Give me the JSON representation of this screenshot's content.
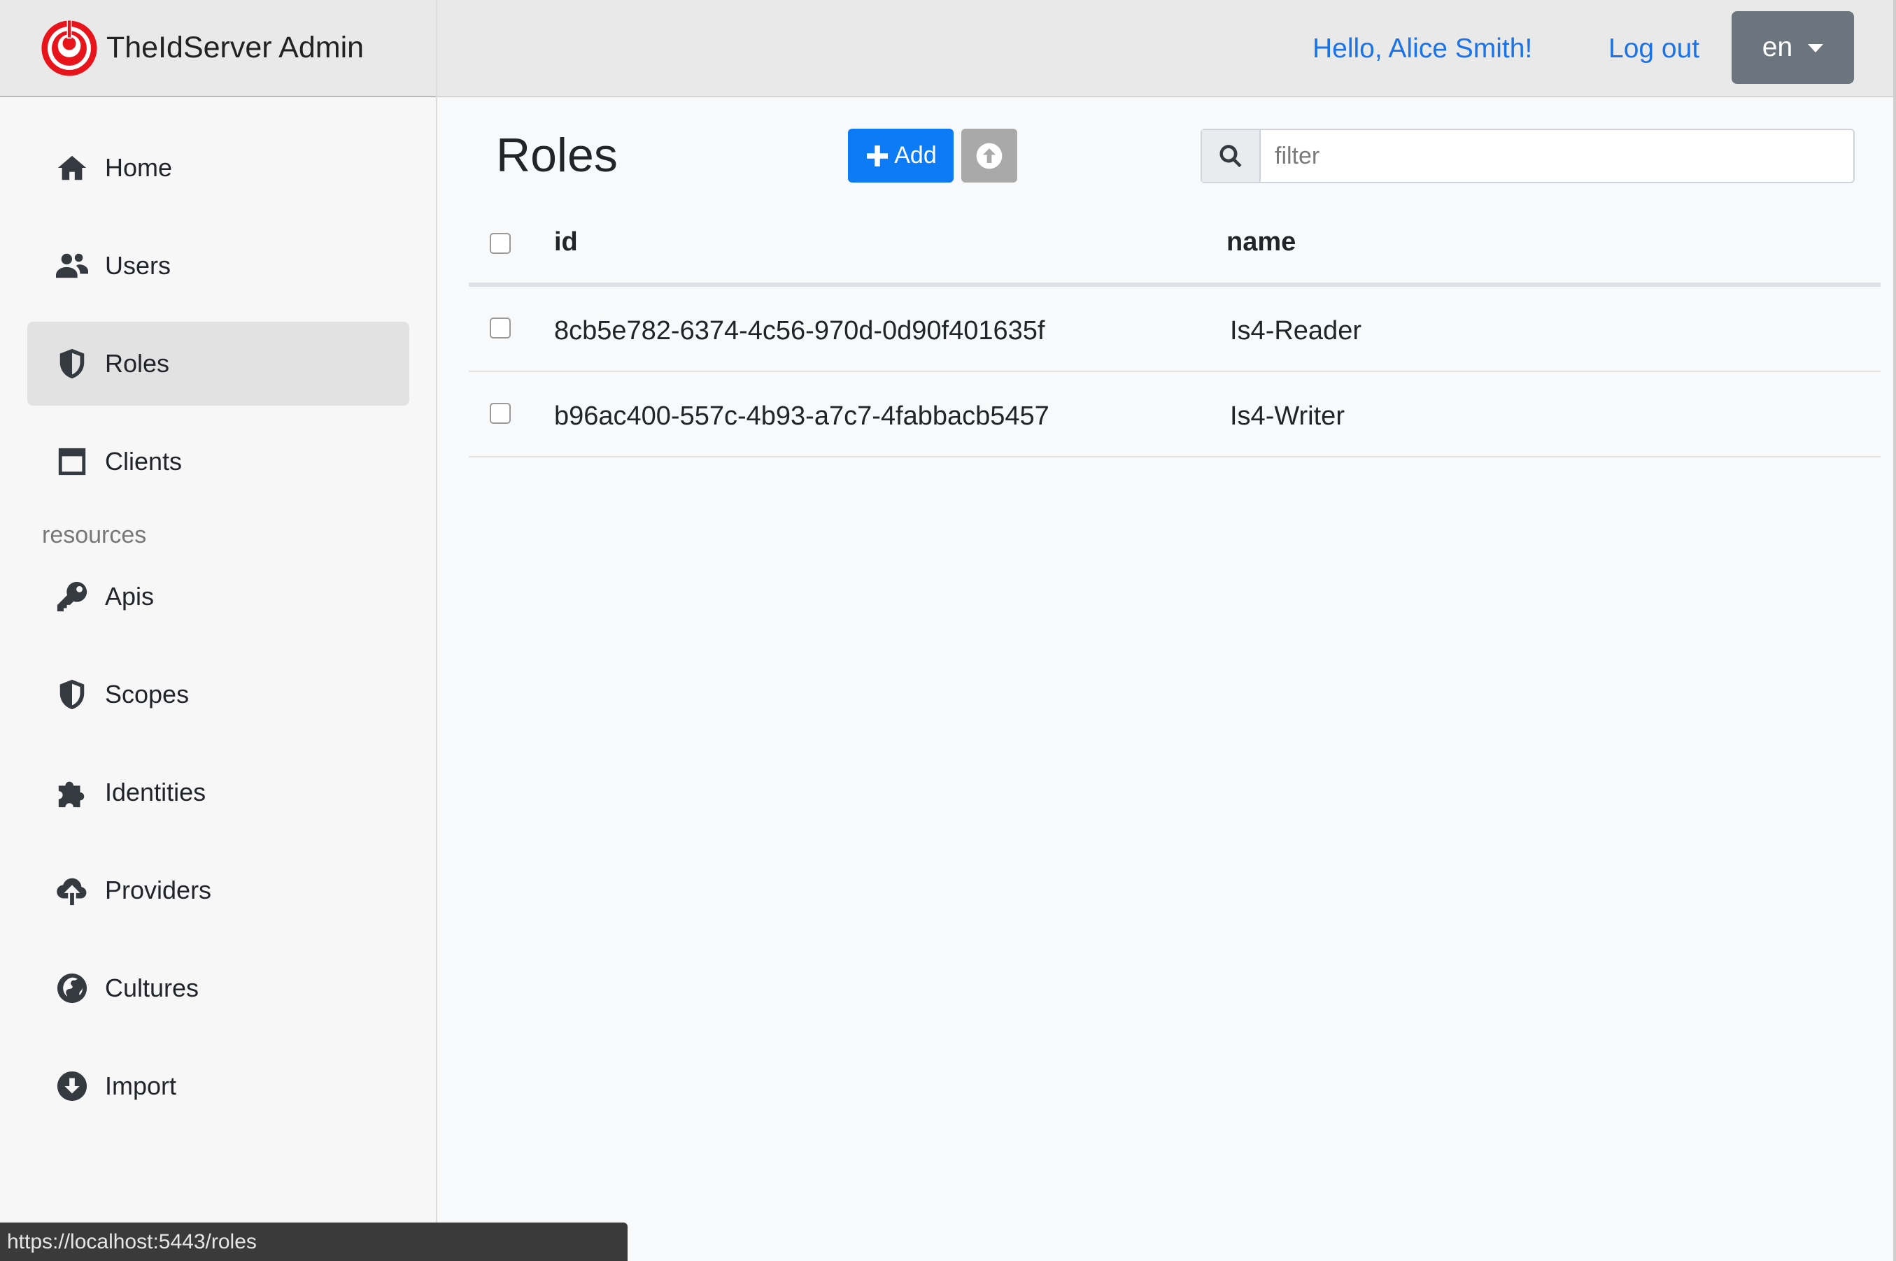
{
  "brand": {
    "title": "TheIdServer Admin",
    "logo_icon": "theidserver-logo",
    "logo_color": "#e8141c"
  },
  "topbar": {
    "greeting": "Hello, Alice Smith!",
    "logout_label": "Log out",
    "language": "en"
  },
  "sidebar": {
    "items": [
      {
        "label": "Home",
        "icon": "home-icon"
      },
      {
        "label": "Users",
        "icon": "users-icon"
      },
      {
        "label": "Roles",
        "icon": "shield-icon",
        "active": true
      },
      {
        "label": "Clients",
        "icon": "window-icon"
      },
      {
        "label": "Apis",
        "icon": "key-icon"
      },
      {
        "label": "Scopes",
        "icon": "shield-icon"
      },
      {
        "label": "Identities",
        "icon": "puzzle-icon"
      },
      {
        "label": "Providers",
        "icon": "cloud-upload-icon"
      },
      {
        "label": "Cultures",
        "icon": "globe-icon"
      },
      {
        "label": "Import",
        "icon": "download-icon"
      }
    ],
    "section_label": "resources"
  },
  "main": {
    "title": "Roles",
    "add_label": "Add",
    "filter_placeholder": "filter",
    "accent_color": "#0d7bf5",
    "table": {
      "columns": [
        "id",
        "name"
      ],
      "rows": [
        {
          "id": "8cb5e782-6374-4c56-970d-0d90f401635f",
          "name": "Is4-Reader"
        },
        {
          "id": "b96ac400-557c-4b93-a7c7-4fabbacb5457",
          "name": "Is4-Writer"
        }
      ]
    }
  },
  "statusbar": {
    "url": "https://localhost:5443/roles"
  }
}
